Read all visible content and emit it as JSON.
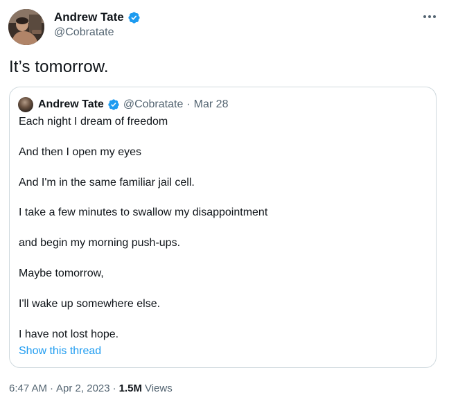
{
  "author": {
    "name": "Andrew Tate",
    "handle": "@Cobratate",
    "verified": true
  },
  "tweet": {
    "text": "It’s tomorrow.",
    "time": "6:47 AM",
    "separator": "·",
    "date": "Apr 2, 2023",
    "views_count": "1.5M",
    "views_label": "Views"
  },
  "quoted": {
    "name": "Andrew Tate",
    "handle": "@Cobratate",
    "separator": "·",
    "date": "Mar 28",
    "lines": [
      "Each night I dream of freedom",
      "And then I open my eyes",
      "And I'm in the same familiar jail cell.",
      "I take a few minutes to swallow my disappointment",
      "and begin my morning push-ups.",
      "Maybe tomorrow,",
      "I'll wake up somewhere else.",
      "I have not lost hope."
    ],
    "show_thread": "Show this thread"
  },
  "colors": {
    "accent": "#1d9bf0",
    "secondary_text": "#536471",
    "primary_text": "#0f1419",
    "border": "#cfd9de"
  },
  "icons": {
    "verified": "verified-badge-icon",
    "more": "more-options-icon"
  }
}
